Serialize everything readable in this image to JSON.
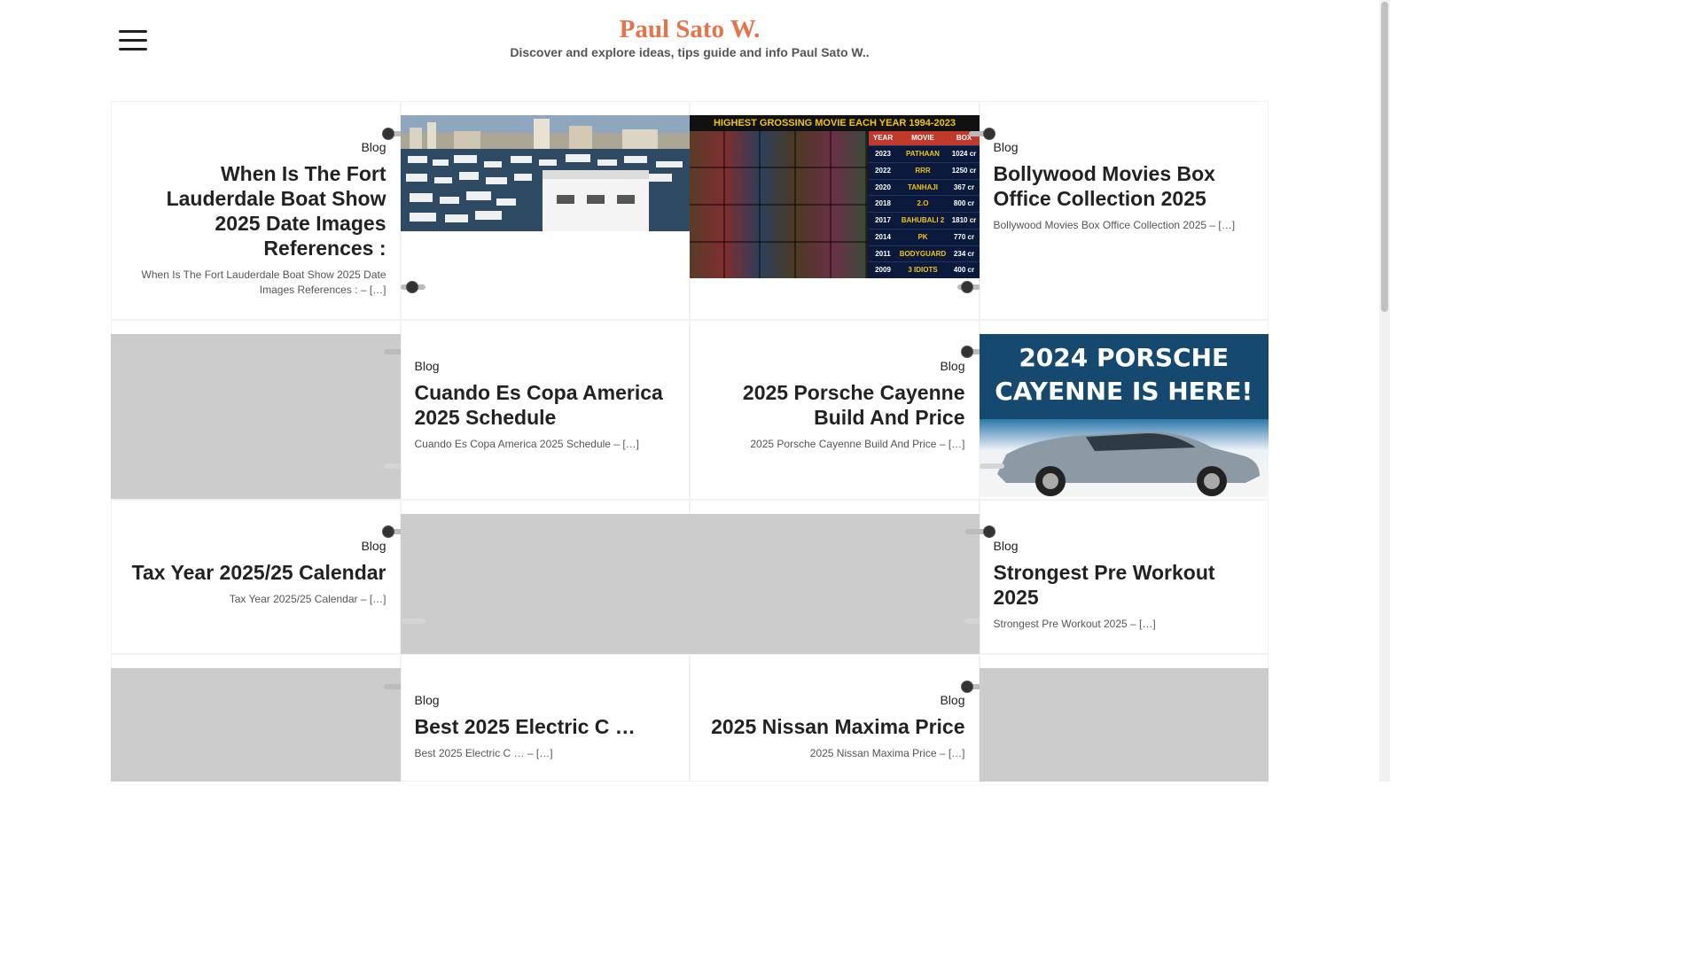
{
  "header": {
    "site_title": "Paul Sato W.",
    "tagline": "Discover and explore ideas, tips guide and info Paul Sato W.."
  },
  "icons": {
    "menu": "hamburger-menu-icon"
  },
  "colors": {
    "site_title": "#e8734a",
    "placeholder": "#cccccc"
  },
  "posts": [
    {
      "category": "Blog",
      "title": "When Is The Fort Lauderdale Boat Show 2025 Date Images References :",
      "excerpt": "When Is The Fort Lauderdale Boat Show 2025 Date Images References : – […]"
    },
    {
      "category": "Blog",
      "title": "Bollywood Movies Box Office Collection 2025",
      "excerpt": "Bollywood Movies Box Office Collection 2025 – […]"
    },
    {
      "category": "Blog",
      "title": "Cuando Es Copa America 2025 Schedule",
      "excerpt": "Cuando Es Copa America 2025 Schedule – […]"
    },
    {
      "category": "Blog",
      "title": "2025 Porsche Cayenne Build And Price",
      "excerpt": "2025 Porsche Cayenne Build And Price – […]"
    },
    {
      "category": "Blog",
      "title": "Tax Year 2025/25 Calendar",
      "excerpt": "Tax Year 2025/25 Calendar – […]"
    },
    {
      "category": "Blog",
      "title": "Strongest Pre Workout 2025",
      "excerpt": "Strongest Pre Workout 2025 – […]"
    },
    {
      "category": "Blog",
      "title": "Best 2025 Electric C …",
      "excerpt": "Best 2025 Electric C … – […]"
    },
    {
      "category": "Blog",
      "title": "2025 Nissan Maxima Price",
      "excerpt": "2025 Nissan Maxima Price – […]"
    }
  ],
  "images": {
    "movie_poster": {
      "heading": "HIGHEST GROSSING MOVIE EACH YEAR 1994-2023",
      "columns": [
        "YEAR",
        "MOVIE",
        "BOX"
      ],
      "rows": [
        [
          "2023",
          "PATHAAN",
          "1024 cr"
        ],
        [
          "2022",
          "RRR",
          "1250 cr"
        ],
        [
          "2020",
          "TANHAJI",
          "367 cr"
        ],
        [
          "2018",
          "2.O",
          "800 cr"
        ],
        [
          "2017",
          "BAHUBALI 2",
          "1810 cr"
        ],
        [
          "2014",
          "PK",
          "770 cr"
        ],
        [
          "2011",
          "BODYGUARD",
          "234 cr"
        ],
        [
          "2009",
          "3 IDIOTS",
          "400 cr"
        ]
      ]
    },
    "porsche": {
      "headline_line1": "2024 PORSCHE",
      "headline_line2": "CAYENNE  IS HERE!"
    }
  }
}
